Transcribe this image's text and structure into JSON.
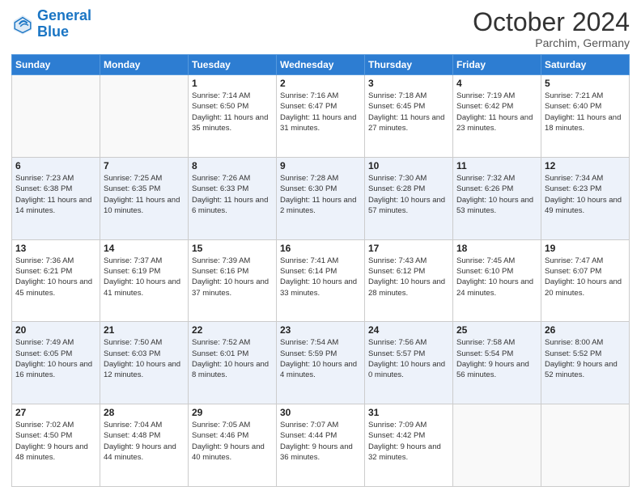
{
  "header": {
    "logo_line1": "General",
    "logo_line2": "Blue",
    "month": "October 2024",
    "location": "Parchim, Germany"
  },
  "weekdays": [
    "Sunday",
    "Monday",
    "Tuesday",
    "Wednesday",
    "Thursday",
    "Friday",
    "Saturday"
  ],
  "rows": [
    [
      {
        "day": "",
        "info": ""
      },
      {
        "day": "",
        "info": ""
      },
      {
        "day": "1",
        "info": "Sunrise: 7:14 AM\nSunset: 6:50 PM\nDaylight: 11 hours and 35 minutes."
      },
      {
        "day": "2",
        "info": "Sunrise: 7:16 AM\nSunset: 6:47 PM\nDaylight: 11 hours and 31 minutes."
      },
      {
        "day": "3",
        "info": "Sunrise: 7:18 AM\nSunset: 6:45 PM\nDaylight: 11 hours and 27 minutes."
      },
      {
        "day": "4",
        "info": "Sunrise: 7:19 AM\nSunset: 6:42 PM\nDaylight: 11 hours and 23 minutes."
      },
      {
        "day": "5",
        "info": "Sunrise: 7:21 AM\nSunset: 6:40 PM\nDaylight: 11 hours and 18 minutes."
      }
    ],
    [
      {
        "day": "6",
        "info": "Sunrise: 7:23 AM\nSunset: 6:38 PM\nDaylight: 11 hours and 14 minutes."
      },
      {
        "day": "7",
        "info": "Sunrise: 7:25 AM\nSunset: 6:35 PM\nDaylight: 11 hours and 10 minutes."
      },
      {
        "day": "8",
        "info": "Sunrise: 7:26 AM\nSunset: 6:33 PM\nDaylight: 11 hours and 6 minutes."
      },
      {
        "day": "9",
        "info": "Sunrise: 7:28 AM\nSunset: 6:30 PM\nDaylight: 11 hours and 2 minutes."
      },
      {
        "day": "10",
        "info": "Sunrise: 7:30 AM\nSunset: 6:28 PM\nDaylight: 10 hours and 57 minutes."
      },
      {
        "day": "11",
        "info": "Sunrise: 7:32 AM\nSunset: 6:26 PM\nDaylight: 10 hours and 53 minutes."
      },
      {
        "day": "12",
        "info": "Sunrise: 7:34 AM\nSunset: 6:23 PM\nDaylight: 10 hours and 49 minutes."
      }
    ],
    [
      {
        "day": "13",
        "info": "Sunrise: 7:36 AM\nSunset: 6:21 PM\nDaylight: 10 hours and 45 minutes."
      },
      {
        "day": "14",
        "info": "Sunrise: 7:37 AM\nSunset: 6:19 PM\nDaylight: 10 hours and 41 minutes."
      },
      {
        "day": "15",
        "info": "Sunrise: 7:39 AM\nSunset: 6:16 PM\nDaylight: 10 hours and 37 minutes."
      },
      {
        "day": "16",
        "info": "Sunrise: 7:41 AM\nSunset: 6:14 PM\nDaylight: 10 hours and 33 minutes."
      },
      {
        "day": "17",
        "info": "Sunrise: 7:43 AM\nSunset: 6:12 PM\nDaylight: 10 hours and 28 minutes."
      },
      {
        "day": "18",
        "info": "Sunrise: 7:45 AM\nSunset: 6:10 PM\nDaylight: 10 hours and 24 minutes."
      },
      {
        "day": "19",
        "info": "Sunrise: 7:47 AM\nSunset: 6:07 PM\nDaylight: 10 hours and 20 minutes."
      }
    ],
    [
      {
        "day": "20",
        "info": "Sunrise: 7:49 AM\nSunset: 6:05 PM\nDaylight: 10 hours and 16 minutes."
      },
      {
        "day": "21",
        "info": "Sunrise: 7:50 AM\nSunset: 6:03 PM\nDaylight: 10 hours and 12 minutes."
      },
      {
        "day": "22",
        "info": "Sunrise: 7:52 AM\nSunset: 6:01 PM\nDaylight: 10 hours and 8 minutes."
      },
      {
        "day": "23",
        "info": "Sunrise: 7:54 AM\nSunset: 5:59 PM\nDaylight: 10 hours and 4 minutes."
      },
      {
        "day": "24",
        "info": "Sunrise: 7:56 AM\nSunset: 5:57 PM\nDaylight: 10 hours and 0 minutes."
      },
      {
        "day": "25",
        "info": "Sunrise: 7:58 AM\nSunset: 5:54 PM\nDaylight: 9 hours and 56 minutes."
      },
      {
        "day": "26",
        "info": "Sunrise: 8:00 AM\nSunset: 5:52 PM\nDaylight: 9 hours and 52 minutes."
      }
    ],
    [
      {
        "day": "27",
        "info": "Sunrise: 7:02 AM\nSunset: 4:50 PM\nDaylight: 9 hours and 48 minutes."
      },
      {
        "day": "28",
        "info": "Sunrise: 7:04 AM\nSunset: 4:48 PM\nDaylight: 9 hours and 44 minutes."
      },
      {
        "day": "29",
        "info": "Sunrise: 7:05 AM\nSunset: 4:46 PM\nDaylight: 9 hours and 40 minutes."
      },
      {
        "day": "30",
        "info": "Sunrise: 7:07 AM\nSunset: 4:44 PM\nDaylight: 9 hours and 36 minutes."
      },
      {
        "day": "31",
        "info": "Sunrise: 7:09 AM\nSunset: 4:42 PM\nDaylight: 9 hours and 32 minutes."
      },
      {
        "day": "",
        "info": ""
      },
      {
        "day": "",
        "info": ""
      }
    ]
  ]
}
